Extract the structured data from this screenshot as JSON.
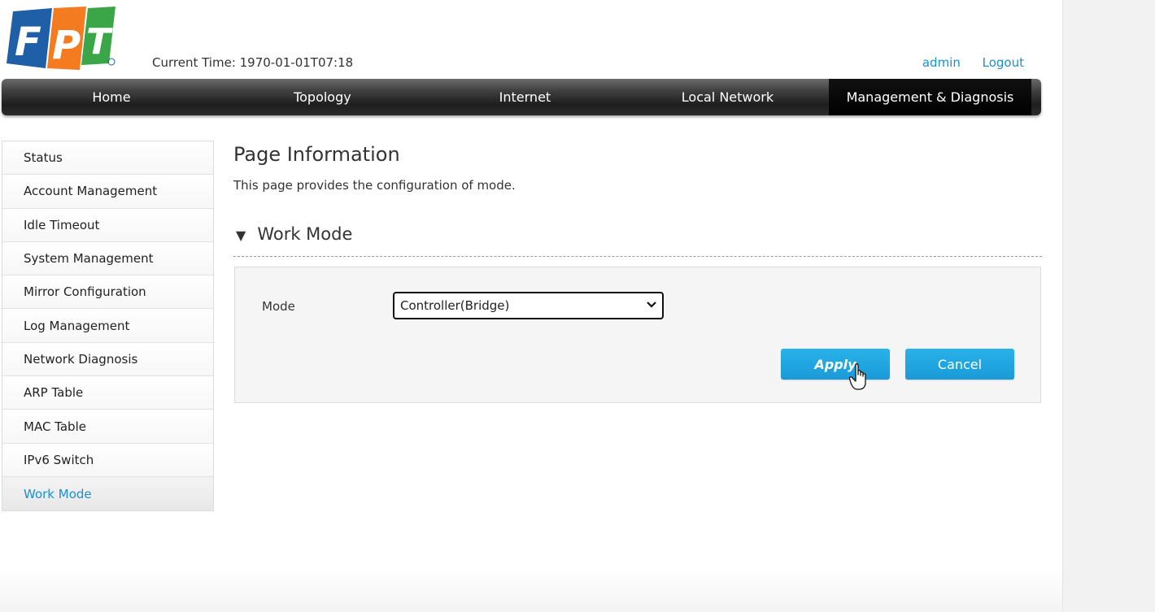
{
  "header": {
    "logo_text": "FPT",
    "current_time": "Current Time: 1970-01-01T07:18",
    "user": "admin",
    "logout": "Logout"
  },
  "nav": {
    "tabs": [
      {
        "label": "Home"
      },
      {
        "label": "Topology"
      },
      {
        "label": "Internet"
      },
      {
        "label": "Local Network"
      },
      {
        "label": "Management & Diagnosis",
        "active": true
      }
    ]
  },
  "sidebar": {
    "items": [
      {
        "label": "Status"
      },
      {
        "label": "Account Management"
      },
      {
        "label": "Idle Timeout"
      },
      {
        "label": "System Management"
      },
      {
        "label": "Mirror Configuration"
      },
      {
        "label": "Log Management"
      },
      {
        "label": "Network Diagnosis"
      },
      {
        "label": "ARP Table"
      },
      {
        "label": "MAC Table"
      },
      {
        "label": "IPv6 Switch"
      },
      {
        "label": "Work Mode",
        "active": true
      }
    ]
  },
  "main": {
    "page_title": "Page Information",
    "page_desc": "This page provides the configuration of mode.",
    "section_title": "Work Mode",
    "mode_label": "Mode",
    "mode_value": "Controller(Bridge)",
    "apply_label": "Apply",
    "cancel_label": "Cancel"
  },
  "colors": {
    "accent": "#1a8fd0",
    "button": "#1a9ad7",
    "logo_blue": "#1f5fa8",
    "logo_orange": "#f47b20",
    "logo_green": "#3aa648"
  }
}
